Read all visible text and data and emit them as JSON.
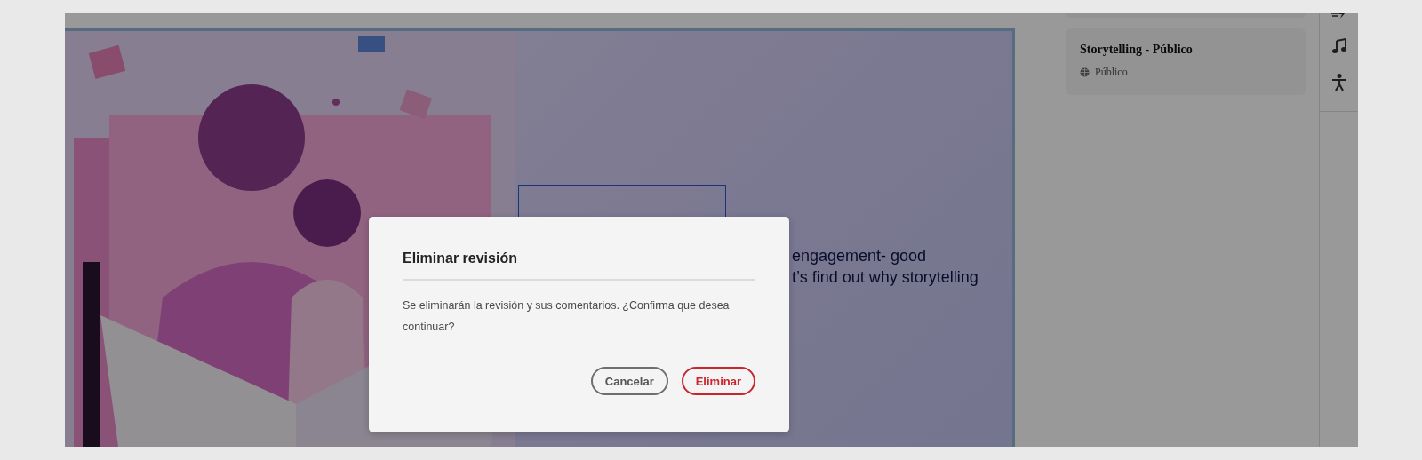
{
  "slide": {
    "title_frame": {
      "selected": true
    },
    "body_lines": [
      "engagement- good",
      "t’s find out why storytelling"
    ]
  },
  "panel": {
    "cards": [
      {
        "title": "Storytelling - Público",
        "visibility": "Público"
      }
    ]
  },
  "dialog": {
    "title": "Eliminar revisión",
    "message": "Se eliminarán la revisión y sus comentarios. ¿Confirma que desea continuar?",
    "buttons": [
      {
        "label": "Cancelar",
        "kind": "secondary"
      },
      {
        "label": "Eliminar",
        "kind": "negative"
      }
    ]
  }
}
